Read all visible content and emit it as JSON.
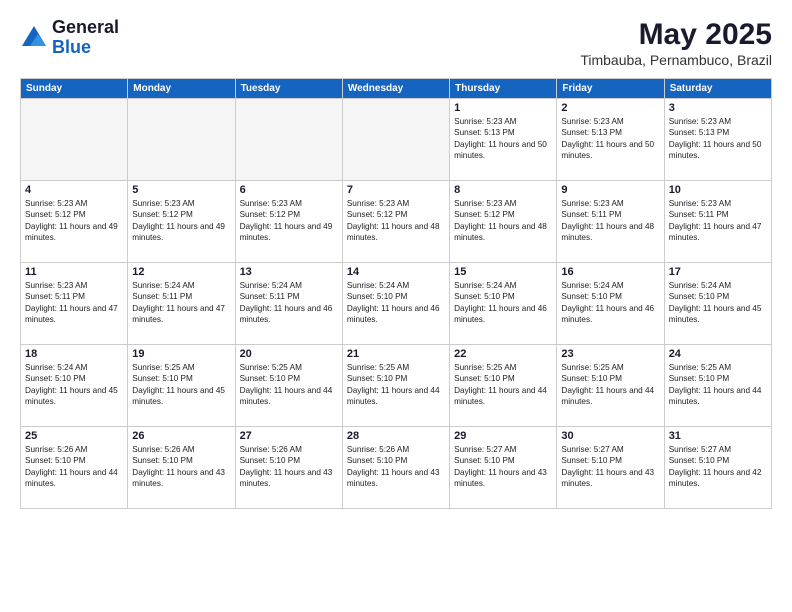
{
  "header": {
    "logo": {
      "line1": "General",
      "line2": "Blue"
    },
    "title": "May 2025",
    "subtitle": "Timbauba, Pernambuco, Brazil"
  },
  "weekdays": [
    "Sunday",
    "Monday",
    "Tuesday",
    "Wednesday",
    "Thursday",
    "Friday",
    "Saturday"
  ],
  "weeks": [
    [
      {
        "day": "",
        "empty": true
      },
      {
        "day": "",
        "empty": true
      },
      {
        "day": "",
        "empty": true
      },
      {
        "day": "",
        "empty": true
      },
      {
        "day": "1",
        "sunrise": "5:23 AM",
        "sunset": "5:13 PM",
        "daylight": "11 hours and 50 minutes."
      },
      {
        "day": "2",
        "sunrise": "5:23 AM",
        "sunset": "5:13 PM",
        "daylight": "11 hours and 50 minutes."
      },
      {
        "day": "3",
        "sunrise": "5:23 AM",
        "sunset": "5:13 PM",
        "daylight": "11 hours and 50 minutes."
      }
    ],
    [
      {
        "day": "4",
        "sunrise": "5:23 AM",
        "sunset": "5:12 PM",
        "daylight": "11 hours and 49 minutes."
      },
      {
        "day": "5",
        "sunrise": "5:23 AM",
        "sunset": "5:12 PM",
        "daylight": "11 hours and 49 minutes."
      },
      {
        "day": "6",
        "sunrise": "5:23 AM",
        "sunset": "5:12 PM",
        "daylight": "11 hours and 49 minutes."
      },
      {
        "day": "7",
        "sunrise": "5:23 AM",
        "sunset": "5:12 PM",
        "daylight": "11 hours and 48 minutes."
      },
      {
        "day": "8",
        "sunrise": "5:23 AM",
        "sunset": "5:12 PM",
        "daylight": "11 hours and 48 minutes."
      },
      {
        "day": "9",
        "sunrise": "5:23 AM",
        "sunset": "5:11 PM",
        "daylight": "11 hours and 48 minutes."
      },
      {
        "day": "10",
        "sunrise": "5:23 AM",
        "sunset": "5:11 PM",
        "daylight": "11 hours and 47 minutes."
      }
    ],
    [
      {
        "day": "11",
        "sunrise": "5:23 AM",
        "sunset": "5:11 PM",
        "daylight": "11 hours and 47 minutes."
      },
      {
        "day": "12",
        "sunrise": "5:24 AM",
        "sunset": "5:11 PM",
        "daylight": "11 hours and 47 minutes."
      },
      {
        "day": "13",
        "sunrise": "5:24 AM",
        "sunset": "5:11 PM",
        "daylight": "11 hours and 46 minutes."
      },
      {
        "day": "14",
        "sunrise": "5:24 AM",
        "sunset": "5:10 PM",
        "daylight": "11 hours and 46 minutes."
      },
      {
        "day": "15",
        "sunrise": "5:24 AM",
        "sunset": "5:10 PM",
        "daylight": "11 hours and 46 minutes."
      },
      {
        "day": "16",
        "sunrise": "5:24 AM",
        "sunset": "5:10 PM",
        "daylight": "11 hours and 46 minutes."
      },
      {
        "day": "17",
        "sunrise": "5:24 AM",
        "sunset": "5:10 PM",
        "daylight": "11 hours and 45 minutes."
      }
    ],
    [
      {
        "day": "18",
        "sunrise": "5:24 AM",
        "sunset": "5:10 PM",
        "daylight": "11 hours and 45 minutes."
      },
      {
        "day": "19",
        "sunrise": "5:25 AM",
        "sunset": "5:10 PM",
        "daylight": "11 hours and 45 minutes."
      },
      {
        "day": "20",
        "sunrise": "5:25 AM",
        "sunset": "5:10 PM",
        "daylight": "11 hours and 44 minutes."
      },
      {
        "day": "21",
        "sunrise": "5:25 AM",
        "sunset": "5:10 PM",
        "daylight": "11 hours and 44 minutes."
      },
      {
        "day": "22",
        "sunrise": "5:25 AM",
        "sunset": "5:10 PM",
        "daylight": "11 hours and 44 minutes."
      },
      {
        "day": "23",
        "sunrise": "5:25 AM",
        "sunset": "5:10 PM",
        "daylight": "11 hours and 44 minutes."
      },
      {
        "day": "24",
        "sunrise": "5:25 AM",
        "sunset": "5:10 PM",
        "daylight": "11 hours and 44 minutes."
      }
    ],
    [
      {
        "day": "25",
        "sunrise": "5:26 AM",
        "sunset": "5:10 PM",
        "daylight": "11 hours and 44 minutes."
      },
      {
        "day": "26",
        "sunrise": "5:26 AM",
        "sunset": "5:10 PM",
        "daylight": "11 hours and 43 minutes."
      },
      {
        "day": "27",
        "sunrise": "5:26 AM",
        "sunset": "5:10 PM",
        "daylight": "11 hours and 43 minutes."
      },
      {
        "day": "28",
        "sunrise": "5:26 AM",
        "sunset": "5:10 PM",
        "daylight": "11 hours and 43 minutes."
      },
      {
        "day": "29",
        "sunrise": "5:27 AM",
        "sunset": "5:10 PM",
        "daylight": "11 hours and 43 minutes."
      },
      {
        "day": "30",
        "sunrise": "5:27 AM",
        "sunset": "5:10 PM",
        "daylight": "11 hours and 43 minutes."
      },
      {
        "day": "31",
        "sunrise": "5:27 AM",
        "sunset": "5:10 PM",
        "daylight": "11 hours and 42 minutes."
      }
    ]
  ]
}
